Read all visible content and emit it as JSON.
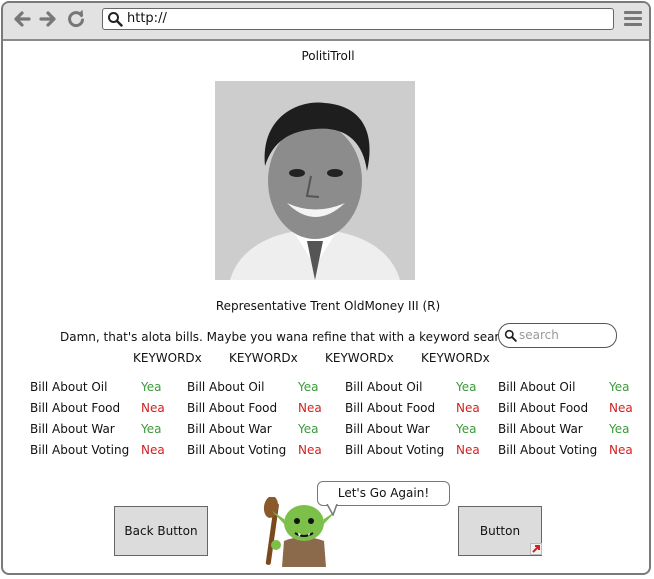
{
  "browser": {
    "url": "http://"
  },
  "page": {
    "title": "PolitiTroll",
    "representative": "Representative Trent OldMoney III (R)",
    "prompt": "Damn, that's alota bills. Maybe you wana refine that with a keyword search:",
    "search_placeholder": "search",
    "keywords": [
      "KEYWORDx",
      "KEYWORDx",
      "KEYWORDx",
      "KEYWORDx"
    ],
    "bill_columns": [
      [
        {
          "bill": "Bill About Oil",
          "vote": "Yea"
        },
        {
          "bill": "Bill About Food",
          "vote": "Nea"
        },
        {
          "bill": "Bill About War",
          "vote": "Yea"
        },
        {
          "bill": "Bill About Voting",
          "vote": "Nea"
        }
      ],
      [
        {
          "bill": "Bill About Oil",
          "vote": "Yea"
        },
        {
          "bill": "Bill About Food",
          "vote": "Nea"
        },
        {
          "bill": "Bill About War",
          "vote": "Yea"
        },
        {
          "bill": "Bill About Voting",
          "vote": "Nea"
        }
      ],
      [
        {
          "bill": "Bill About Oil",
          "vote": "Yea"
        },
        {
          "bill": "Bill About Food",
          "vote": "Nea"
        },
        {
          "bill": "Bill About War",
          "vote": "Yea"
        },
        {
          "bill": "Bill About Voting",
          "vote": "Nea"
        }
      ],
      [
        {
          "bill": "Bill About Oil",
          "vote": "Yea"
        },
        {
          "bill": "Bill About Food",
          "vote": "Nea"
        },
        {
          "bill": "Bill About War",
          "vote": "Yea"
        },
        {
          "bill": "Bill About Voting",
          "vote": "Nea"
        }
      ]
    ],
    "back_button": "Back Button",
    "button": "Button",
    "speech_bubble": "Let's Go Again!"
  },
  "colors": {
    "yea": "#3c9a3c",
    "nea": "#d42020",
    "button_bg": "#dcdcdc"
  },
  "icons": {
    "back": "arrow-left-icon",
    "forward": "arrow-right-icon",
    "reload": "reload-icon",
    "menu": "hamburger-menu-icon",
    "search": "search-icon"
  }
}
